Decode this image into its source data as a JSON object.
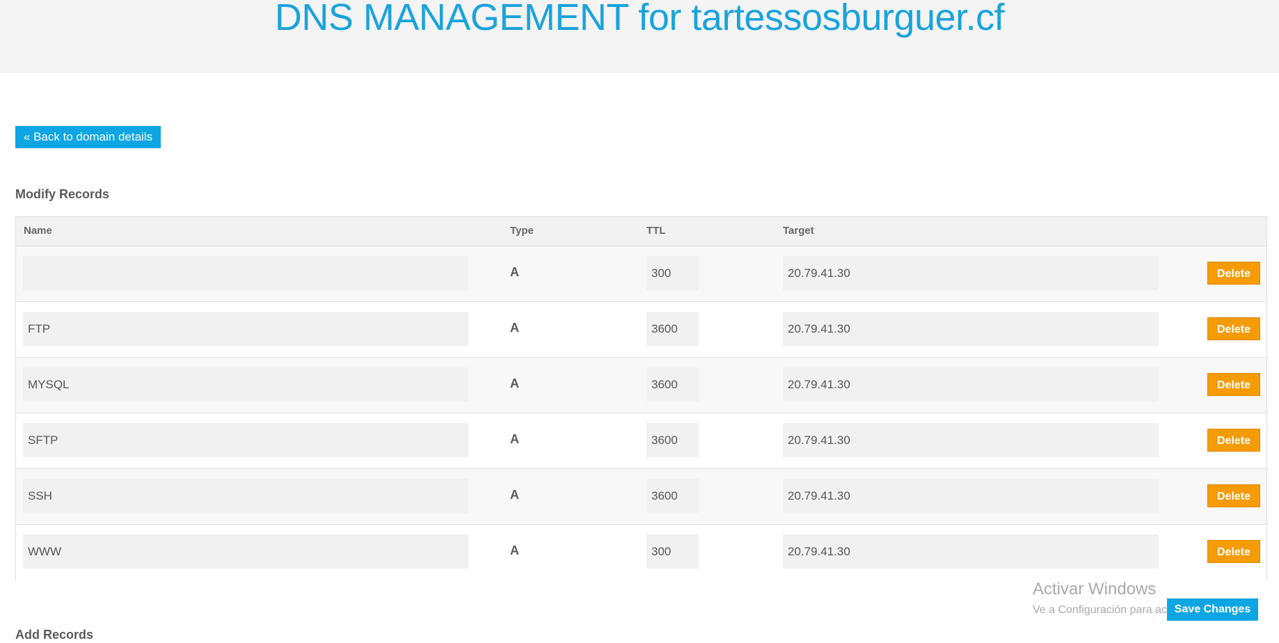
{
  "header": {
    "title": "DNS MANAGEMENT for tartessosburguer.cf"
  },
  "back_button": {
    "label": "« Back to domain details"
  },
  "modify_records": {
    "title": "Modify Records",
    "columns": [
      "Name",
      "Type",
      "TTL",
      "Target"
    ],
    "rows": [
      {
        "name": "",
        "type": "A",
        "ttl": "300",
        "target": "20.79.41.30",
        "delete_label": "Delete"
      },
      {
        "name": "FTP",
        "type": "A",
        "ttl": "3600",
        "target": "20.79.41.30",
        "delete_label": "Delete"
      },
      {
        "name": "MYSQL",
        "type": "A",
        "ttl": "3600",
        "target": "20.79.41.30",
        "delete_label": "Delete"
      },
      {
        "name": "SFTP",
        "type": "A",
        "ttl": "3600",
        "target": "20.79.41.30",
        "delete_label": "Delete"
      },
      {
        "name": "SSH",
        "type": "A",
        "ttl": "3600",
        "target": "20.79.41.30",
        "delete_label": "Delete"
      },
      {
        "name": "WWW",
        "type": "A",
        "ttl": "300",
        "target": "20.79.41.30",
        "delete_label": "Delete"
      }
    ]
  },
  "save_button": {
    "label": "Save Changes"
  },
  "add_records": {
    "title": "Add Records"
  },
  "watermark": {
    "title": "Activar Windows",
    "subtitle": "Ve a Configuración para activar Windows."
  },
  "colors": {
    "accent_blue": "#0ea5e3",
    "title_blue": "#1aa3dc",
    "delete_orange": "#f59b06",
    "header_bg": "#f4f4f4"
  }
}
